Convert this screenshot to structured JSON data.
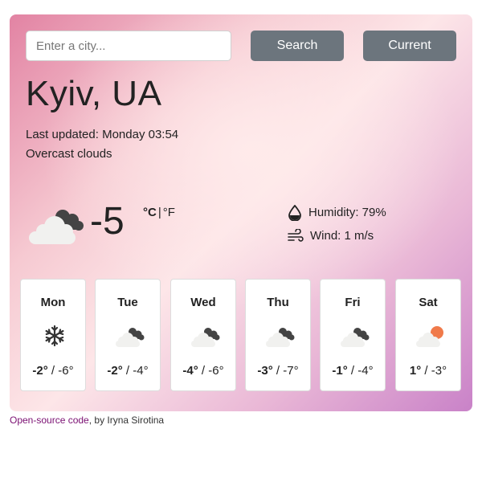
{
  "search": {
    "placeholder": "Enter a city...",
    "search_label": "Search",
    "current_label": "Current"
  },
  "location": {
    "city": "Kyiv, UA",
    "last_updated": "Last updated: Monday 03:54",
    "description": "Overcast clouds"
  },
  "current": {
    "icon": "overcast-clouds-icon",
    "temperature": "-5",
    "unit_c": "°C",
    "unit_separator": "|",
    "unit_f": "°F",
    "humidity": "Humidity: 79%",
    "wind": "Wind: 1 m/s"
  },
  "forecast": [
    {
      "day": "Mon",
      "icon": "snowflake-icon",
      "high": "-2°",
      "low": "-6°"
    },
    {
      "day": "Tue",
      "icon": "broken-clouds-icon",
      "high": "-2°",
      "low": "-4°"
    },
    {
      "day": "Wed",
      "icon": "broken-clouds-icon",
      "high": "-4°",
      "low": "-6°"
    },
    {
      "day": "Thu",
      "icon": "broken-clouds-icon",
      "high": "-3°",
      "low": "-7°"
    },
    {
      "day": "Fri",
      "icon": "broken-clouds-icon",
      "high": "-1°",
      "low": "-4°"
    },
    {
      "day": "Sat",
      "icon": "sun-behind-cloud-icon",
      "high": "1°",
      "low": "-3°"
    }
  ],
  "footer": {
    "link_text": "Open-source code",
    "by_text": ", by Iryna Sirotina"
  },
  "colors": {
    "button": "#6c757d",
    "link": "#7a0f72",
    "sun": "#f07a4a"
  }
}
